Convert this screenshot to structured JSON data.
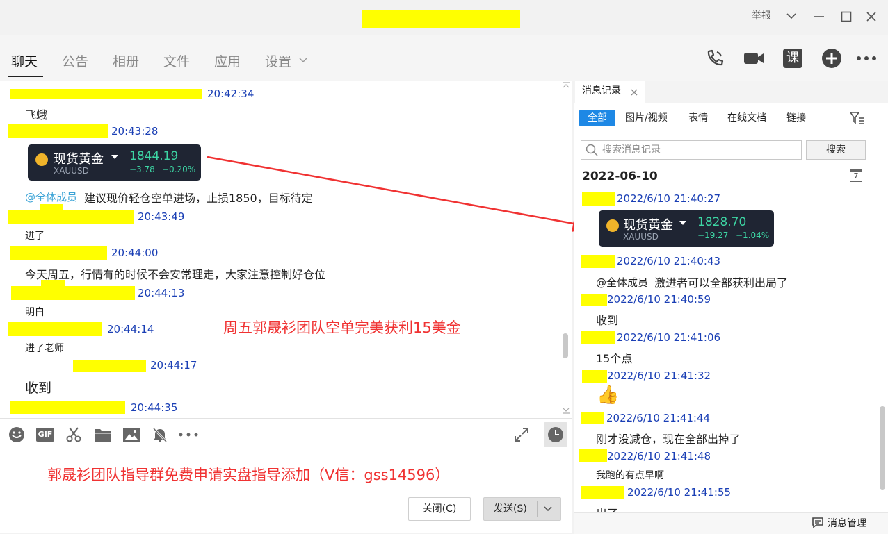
{
  "window": {
    "report_label": "举报",
    "colors": {
      "highlight": "#ffff00",
      "time_blue": "#1a3fb5",
      "mention": "#3aa3d6",
      "overlay_red": "#f03232",
      "accent_blue": "#1e88e5"
    }
  },
  "tabs": [
    "聊天",
    "公告",
    "相册",
    "文件",
    "应用",
    "设置"
  ],
  "top_icons": [
    "phone-icon",
    "video-icon",
    "lesson-icon",
    "add-icon",
    "more-icon"
  ],
  "lesson_icon_glyph": "课",
  "chat": {
    "messages": [
      {
        "time": "20:42:34",
        "text": "飞蛾"
      },
      {
        "time": "20:43:28",
        "card": {
          "name": "现货黄金",
          "symbol": "XAUUSD",
          "price": "1844.19",
          "change": "−3.78",
          "change_pct": "−0.20%"
        }
      },
      {
        "mention": "@全体成员",
        "text": "建议现价轻仓空单进场，止损1850，目标待定"
      },
      {
        "time": "20:43:49",
        "text": "进了"
      },
      {
        "time": "20:44:00",
        "text": "今天周五，行情有的时候不会安常理走，大家注意控制好仓位"
      },
      {
        "time": "20:44:13",
        "text": "明白"
      },
      {
        "time": "20:44:14",
        "text": "进了老师"
      },
      {
        "time": "20:44:17",
        "text": "收到"
      },
      {
        "time": "20:44:35"
      }
    ],
    "overlay_text": "周五郭晟衫团队空单完美获利15美金",
    "input_overlay_text": "郭晟衫团队指导群免费申请实盘指导添加（V信：gss14596）"
  },
  "toolbar": {
    "icons": [
      "emoji-icon",
      "gif-icon",
      "scissors-icon",
      "folder-icon",
      "image-icon",
      "mute-bell-icon",
      "more-icon",
      "expand-icon",
      "history-clock-icon"
    ],
    "gif_label": "GIF",
    "close_label": "关闭(C)",
    "send_label": "发送(S)"
  },
  "panel": {
    "tab_label": "消息记录",
    "filter_tabs": [
      "全部",
      "图片/视频",
      "表情",
      "在线文档",
      "链接"
    ],
    "search_placeholder": "搜索消息记录",
    "search_button": "搜索",
    "date": "2022-06-10",
    "calendar_day": "7",
    "records": [
      {
        "time": "2022/6/10 21:40:27",
        "card": {
          "name": "现货黄金",
          "symbol": "XAUUSD",
          "price": "1828.70",
          "change": "−19.27",
          "change_pct": "−1.04%"
        }
      },
      {
        "time": "2022/6/10 21:40:43",
        "mention": "@全体成员",
        "text": "激进者可以全部获利出局了"
      },
      {
        "time": "2022/6/10 21:40:59",
        "text": "收到"
      },
      {
        "time": "2022/6/10 21:41:06",
        "text": "15个点"
      },
      {
        "time": "2022/6/10 21:41:32",
        "emoji": "👍"
      },
      {
        "time": "2022/6/10 21:41:44",
        "text": "刚才没减仓，现在全部出掉了"
      },
      {
        "time": "2022/6/10 21:41:48",
        "text": "我跑的有点早啊"
      },
      {
        "time": "2022/6/10 21:41:55",
        "text": "出了"
      }
    ],
    "bottom_label": "消息管理"
  }
}
